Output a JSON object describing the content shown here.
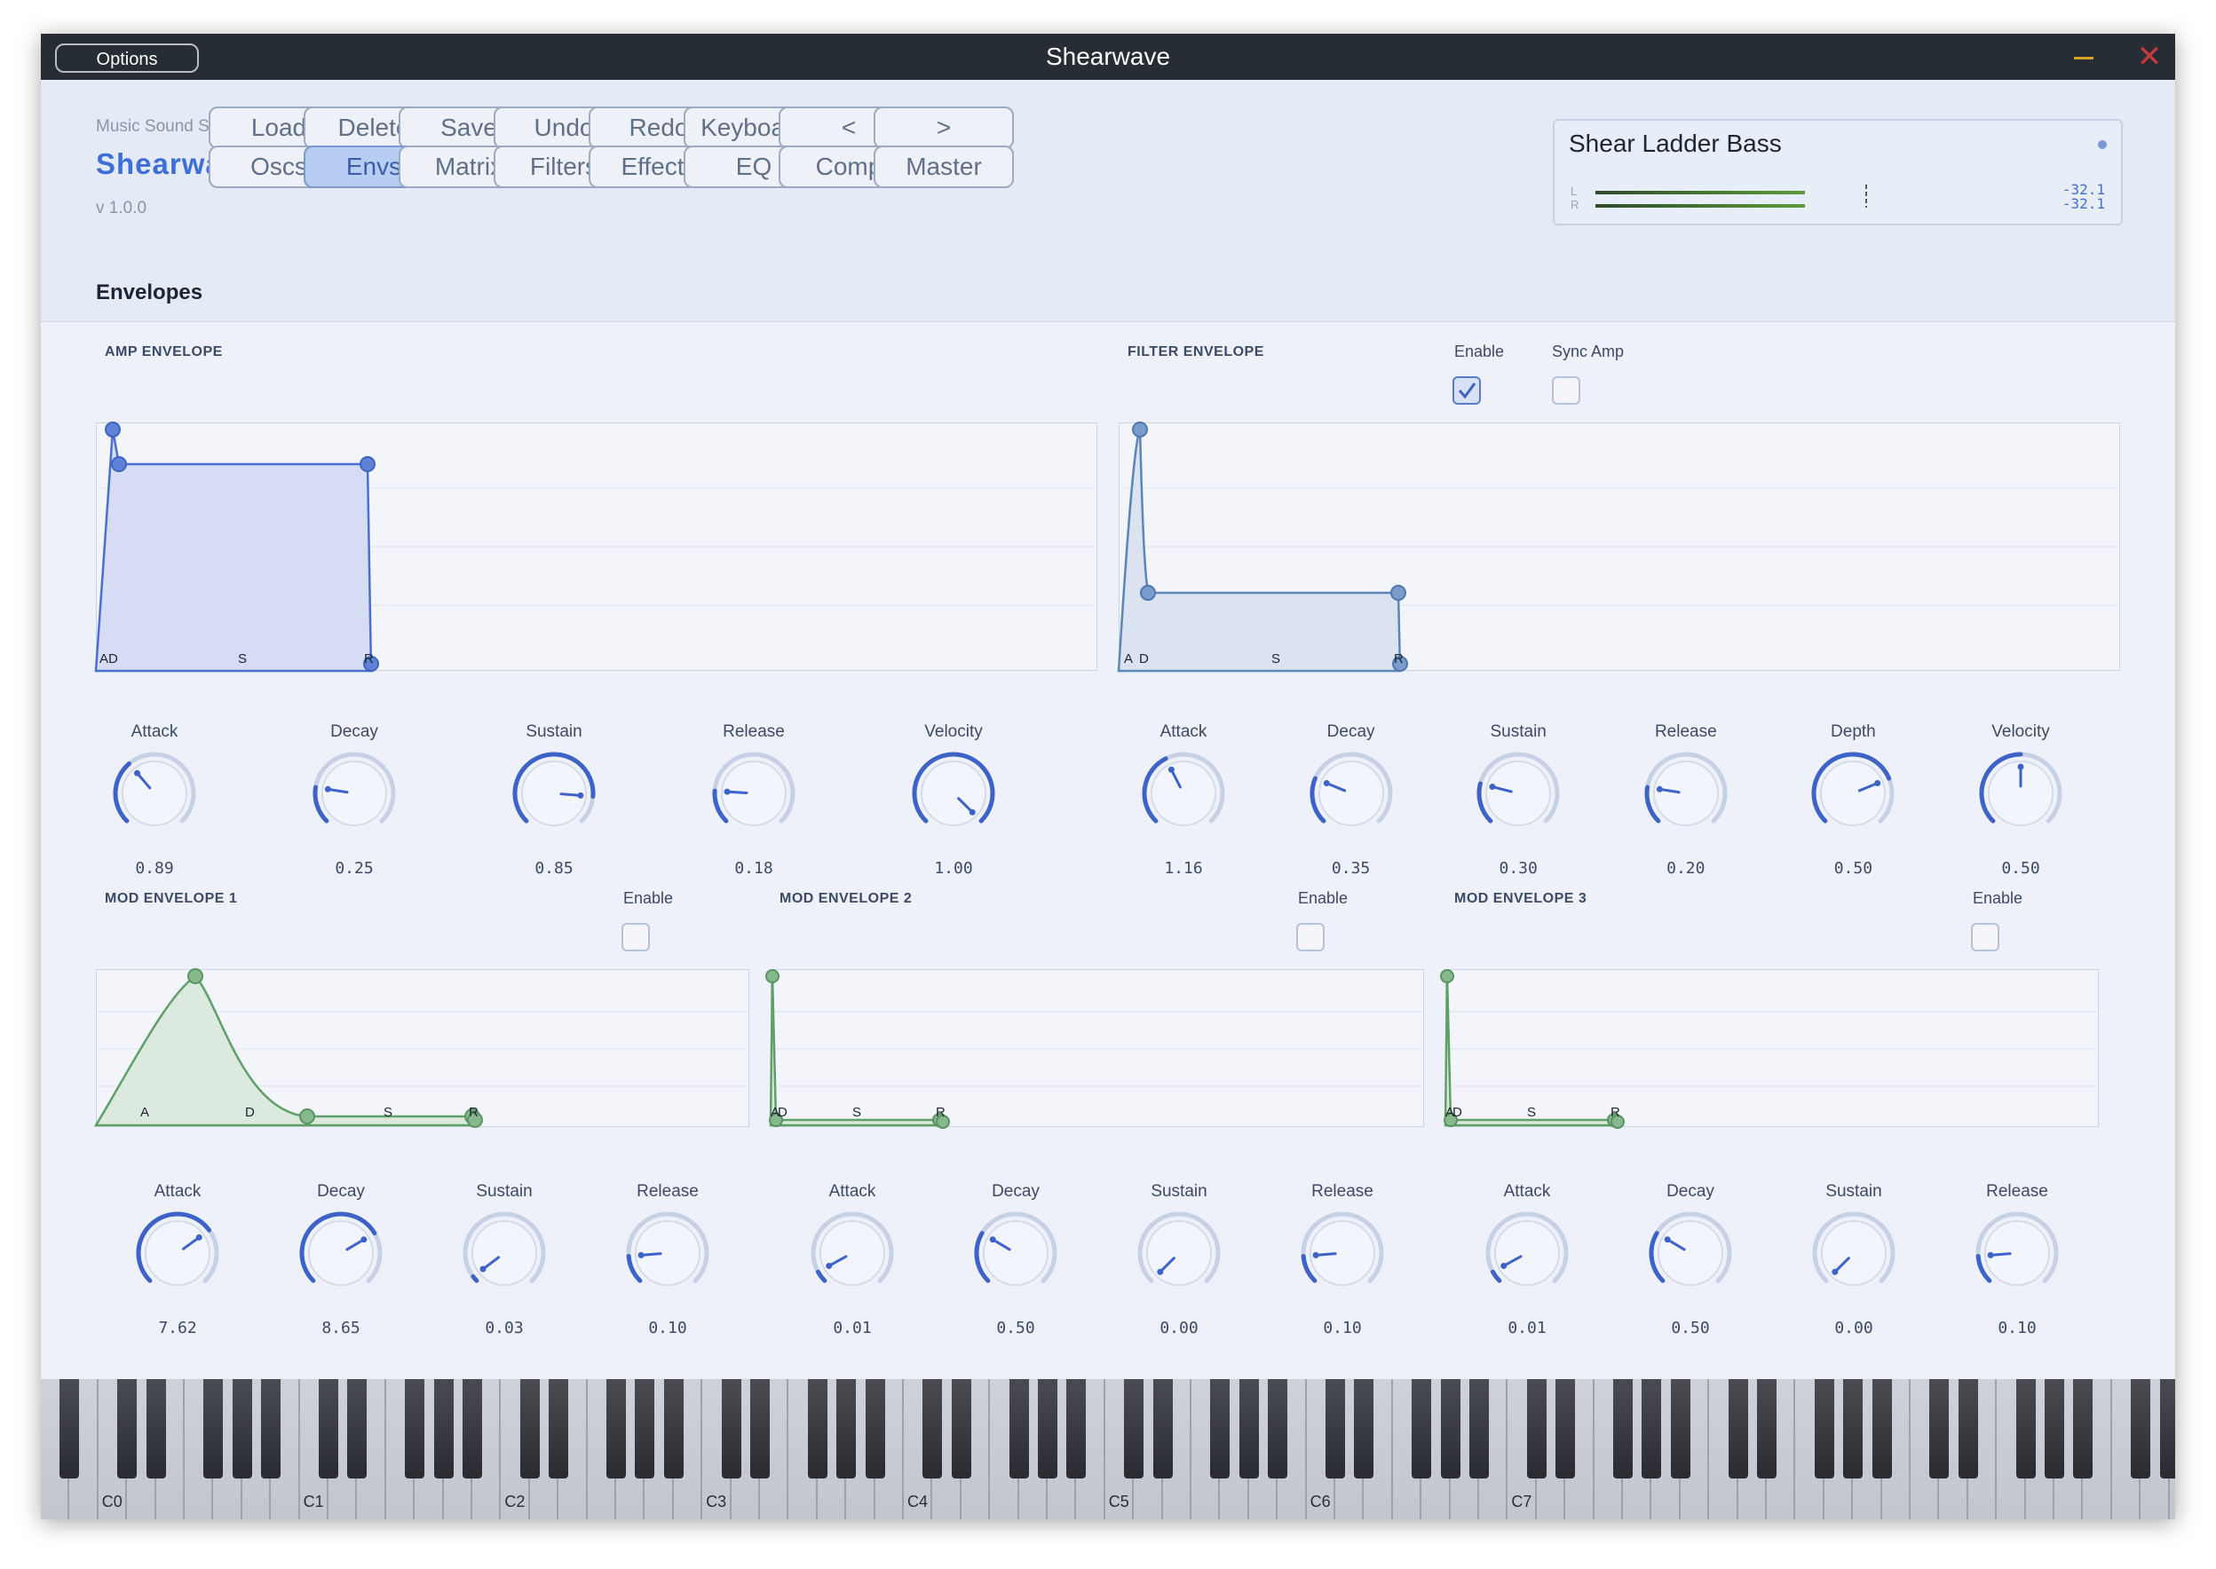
{
  "window": {
    "title": "Shearwave",
    "options_label": "Options"
  },
  "brand": {
    "company": "Music Sound Software",
    "name": "Shearwave",
    "version": "v 1.0.0"
  },
  "toolbar": {
    "row1": [
      "Load",
      "Delete",
      "Save",
      "Undo",
      "Redo",
      "Keyboard",
      "<",
      ">"
    ],
    "row2": [
      "Oscs",
      "Envs",
      "Matrix",
      "Filters",
      "Effects",
      "EQ",
      "Comp",
      "Master"
    ],
    "active": "Envs"
  },
  "preset": {
    "name": "Shear Ladder Bass",
    "meter_l_label": "L",
    "meter_r_label": "R",
    "meter_l_value": "-32.1",
    "meter_r_value": "-32.1"
  },
  "section_title": "Envelopes",
  "amp_env": {
    "title": "AMP ENVELOPE",
    "marker_ad": "AD",
    "marker_s": "S",
    "marker_r": "R",
    "knobs": [
      {
        "label": "Attack",
        "value": "0.89",
        "level": 0.35
      },
      {
        "label": "Decay",
        "value": "0.25",
        "level": 0.2
      },
      {
        "label": "Sustain",
        "value": "0.85",
        "level": 0.85
      },
      {
        "label": "Release",
        "value": "0.18",
        "level": 0.18
      },
      {
        "label": "Velocity",
        "value": "1.00",
        "level": 1.0
      }
    ]
  },
  "filter_env": {
    "title": "FILTER ENVELOPE",
    "enable_label": "Enable",
    "enable_checked": true,
    "sync_label": "Sync Amp",
    "sync_checked": false,
    "marker_a": "A",
    "marker_d": "D",
    "marker_s": "S",
    "marker_r": "R",
    "knobs": [
      {
        "label": "Attack",
        "value": "1.16",
        "level": 0.4
      },
      {
        "label": "Decay",
        "value": "0.35",
        "level": 0.25
      },
      {
        "label": "Sustain",
        "value": "0.30",
        "level": 0.22
      },
      {
        "label": "Release",
        "value": "0.20",
        "level": 0.2
      },
      {
        "label": "Depth",
        "value": "0.50",
        "level": 0.75
      },
      {
        "label": "Velocity",
        "value": "0.50",
        "level": 0.5
      }
    ]
  },
  "mod_envs": [
    {
      "title": "MOD ENVELOPE 1",
      "enable_label": "Enable",
      "enabled": false,
      "marker_a": "A",
      "marker_d": "D",
      "marker_s": "S",
      "marker_r": "R",
      "knobs": [
        {
          "label": "Attack",
          "value": "7.62",
          "level": 0.7
        },
        {
          "label": "Decay",
          "value": "8.65",
          "level": 0.72
        },
        {
          "label": "Sustain",
          "value": "0.03",
          "level": 0.03
        },
        {
          "label": "Release",
          "value": "0.10",
          "level": 0.15
        }
      ]
    },
    {
      "title": "MOD ENVELOPE 2",
      "enable_label": "Enable",
      "enabled": false,
      "marker_a": "A",
      "marker_d": "D",
      "marker_s": "S",
      "marker_r": "R",
      "knobs": [
        {
          "label": "Attack",
          "value": "0.01",
          "level": 0.06
        },
        {
          "label": "Decay",
          "value": "0.50",
          "level": 0.28
        },
        {
          "label": "Sustain",
          "value": "0.00",
          "level": 0.0
        },
        {
          "label": "Release",
          "value": "0.10",
          "level": 0.15
        }
      ]
    },
    {
      "title": "MOD ENVELOPE 3",
      "enable_label": "Enable",
      "enabled": false,
      "marker_a": "A",
      "marker_d": "D",
      "marker_s": "S",
      "marker_r": "R",
      "knobs": [
        {
          "label": "Attack",
          "value": "0.01",
          "level": 0.06
        },
        {
          "label": "Decay",
          "value": "0.50",
          "level": 0.28
        },
        {
          "label": "Sustain",
          "value": "0.00",
          "level": 0.0
        },
        {
          "label": "Release",
          "value": "0.10",
          "level": 0.15
        }
      ]
    }
  ],
  "keyboard": {
    "octave_labels": [
      "C0",
      "C1",
      "C2",
      "C3",
      "C4",
      "C5",
      "C6",
      "C7"
    ]
  },
  "colors": {
    "accent": "#3e6fd8",
    "amp": "#4a6fd1",
    "filter": "#5d86b8",
    "mod": "#5f9f68",
    "meter": "#5b9c3a"
  }
}
